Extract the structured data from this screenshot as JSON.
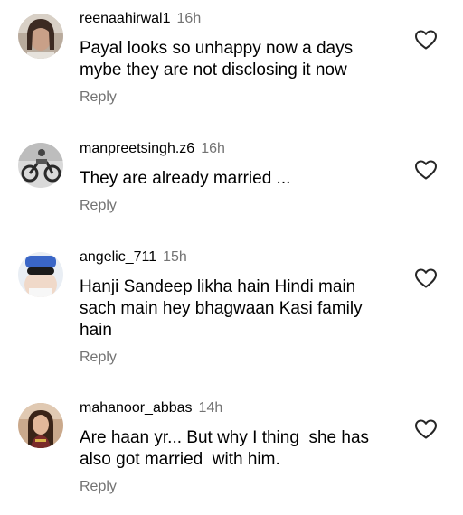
{
  "comments": [
    {
      "username": "reenaahirwal1",
      "time": "16h",
      "text_lines": [
        "Payal looks so unhappy now a days",
        "mybe they are not disclosing it now"
      ],
      "reply_label": "Reply",
      "avatar_icon": "user-photo-avatar",
      "like_icon": "heart-outline-icon"
    },
    {
      "username": "manpreetsingh.z6",
      "time": "16h",
      "text_lines": [
        "They are already married ..."
      ],
      "reply_label": "Reply",
      "avatar_icon": "motorcycle-photo-avatar",
      "like_icon": "heart-outline-icon"
    },
    {
      "username": "angelic_711",
      "time": "15h",
      "text_lines": [
        "Hanji Sandeep likha hain Hindi main",
        "sach main hey bhagwaan Kasi family",
        "hain"
      ],
      "reply_label": "Reply",
      "avatar_icon": "user-sunglasses-avatar",
      "like_icon": "heart-outline-icon"
    },
    {
      "username": "mahanoor_abbas",
      "time": "14h",
      "text_lines": [
        "Are haan yr... But why I thing  she has",
        "also got married  with him."
      ],
      "reply_label": "Reply",
      "avatar_icon": "user-photo-avatar",
      "like_icon": "heart-outline-icon"
    }
  ],
  "colors": {
    "text": "#000000",
    "secondary": "#737373",
    "background": "#ffffff"
  }
}
